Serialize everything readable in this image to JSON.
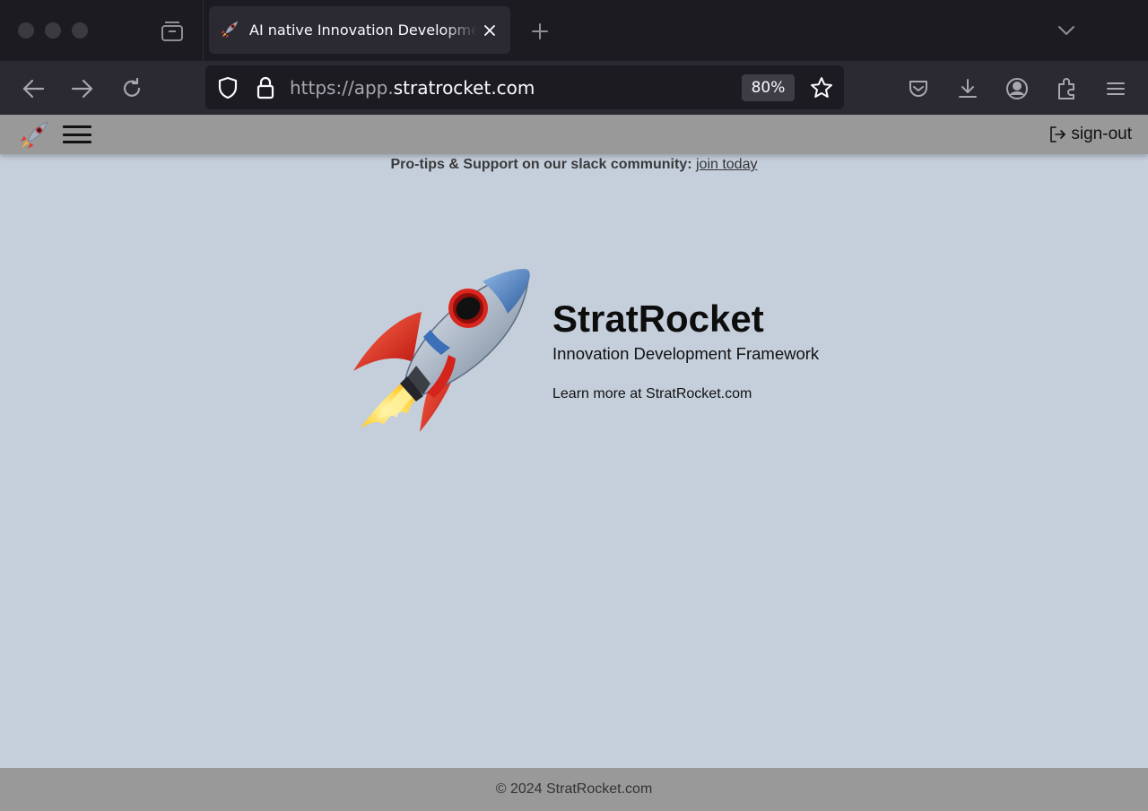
{
  "browser": {
    "tab": {
      "title": "AI native Innovation Development Framework | StratRocket",
      "close_icon": "close-icon",
      "favicon": "rocket-icon"
    },
    "url": {
      "scheme": "https://app.",
      "host": "stratrocket.com"
    },
    "zoom": "80%"
  },
  "app": {
    "header": {
      "signout_label": "sign-out"
    },
    "protip": {
      "text": "Pro-tips & Support on our slack community:",
      "link": "join today"
    },
    "hero": {
      "title": "StratRocket",
      "subtitle": "Innovation Development Framework",
      "learn_more": "Learn more at StratRocket.com"
    },
    "footer": {
      "text": "© 2024 StratRocket.com"
    }
  },
  "colors": {
    "chrome_dark": "#1c1b22",
    "chrome_toolbar": "#2b2a33",
    "page_background": "#c5cfdc",
    "app_bar": "#999999"
  }
}
